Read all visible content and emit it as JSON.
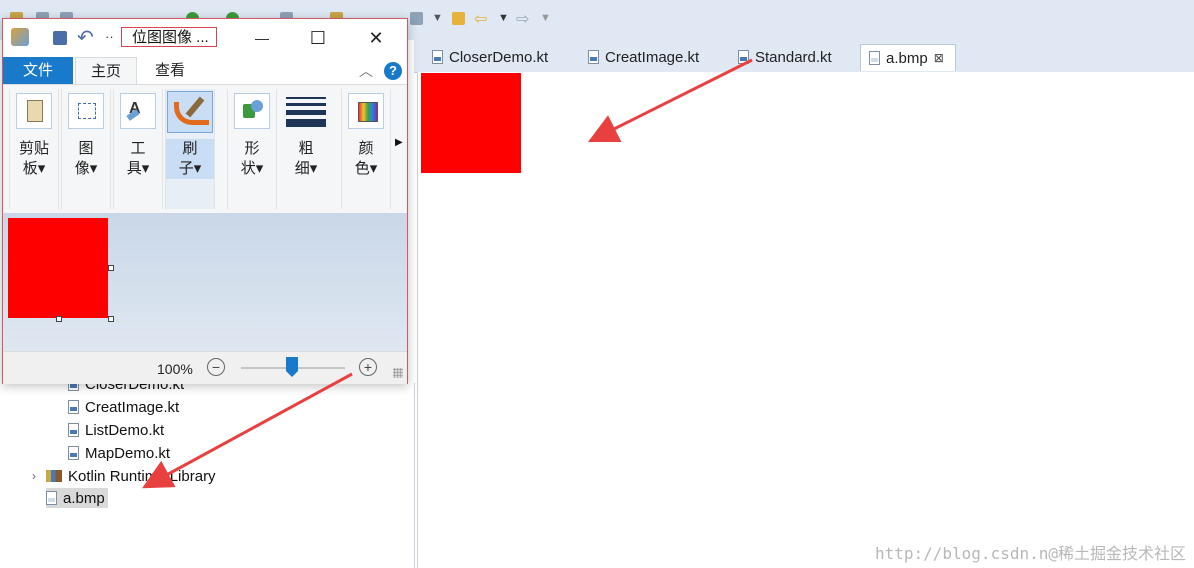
{
  "editor_tabs": [
    {
      "label": "CloserDemo.kt",
      "active": false
    },
    {
      "label": "CreatImage.kt",
      "active": false
    },
    {
      "label": "Standard.kt",
      "active": false
    },
    {
      "label": "a.bmp",
      "active": true,
      "close": "⊠"
    }
  ],
  "project_tree": {
    "items": [
      {
        "label": "CloserDemo.kt"
      },
      {
        "label": "CreatImage.kt"
      },
      {
        "label": "ListDemo.kt"
      },
      {
        "label": "MapDemo.kt"
      },
      {
        "label": "Kotlin Runtime Library"
      },
      {
        "label": "a.bmp"
      }
    ]
  },
  "paint": {
    "title": "位图图像 ...",
    "more_glyph": "··",
    "tabs": {
      "file": "文件",
      "home": "主页",
      "view": "查看"
    },
    "groups": {
      "clipboard": {
        "line1": "剪贴",
        "line2": "板▾"
      },
      "image": {
        "line1": "图",
        "line2": "像▾"
      },
      "tools": {
        "line1": "工",
        "line2": "具▾"
      },
      "brushes": {
        "line1": "刷",
        "line2": "子▾"
      },
      "shapes": {
        "line1": "形",
        "line2": "状▾"
      },
      "size": {
        "line1": "粗",
        "line2": "细▾"
      },
      "colors": {
        "line1": "颜",
        "line2": "色▾"
      }
    },
    "zoom": {
      "label": "100%",
      "minus": "−",
      "plus": "+",
      "level_percent": 100
    },
    "window_buttons": {
      "minimize": "—",
      "maximize": "☐",
      "close": "✕"
    }
  },
  "colors": {
    "image_fill": "#ff0000",
    "arrow": "#e8403f",
    "ribbon_accent": "#1979ca"
  },
  "watermark": "http://blog.csdn.n@稀土掘金技术社区"
}
